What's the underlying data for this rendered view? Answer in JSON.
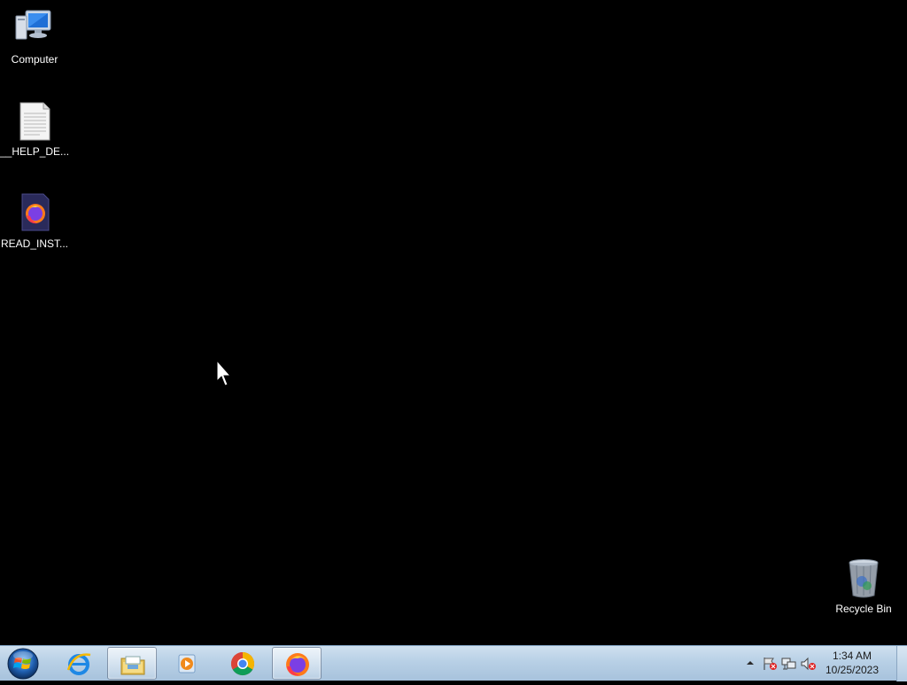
{
  "desktop": {
    "icons": [
      {
        "label": "Computer",
        "icon": "computer-icon"
      },
      {
        "label": "__HELP_DE...",
        "icon": "text-file-icon"
      },
      {
        "label": "READ_INST...",
        "icon": "firefox-file-icon"
      },
      {
        "label": "Recycle Bin",
        "icon": "recycle-bin-icon"
      }
    ]
  },
  "taskbar": {
    "pinned": [
      {
        "icon": "internet-explorer-icon",
        "active": false
      },
      {
        "icon": "file-explorer-icon",
        "active": true
      },
      {
        "icon": "media-player-icon",
        "active": false
      },
      {
        "icon": "chrome-icon",
        "active": false
      },
      {
        "icon": "firefox-icon",
        "active": true
      }
    ],
    "tray": {
      "icons": [
        "show-hidden-icons-arrow",
        "action-center-flag-icon",
        "network-icon",
        "volume-muted-icon"
      ],
      "time": "1:34 AM",
      "date": "10/25/2023"
    }
  },
  "colors": {
    "desktop_bg": "#000000",
    "taskbar_top": "#cfe0ef",
    "taskbar_bottom": "#a7c2dc"
  }
}
